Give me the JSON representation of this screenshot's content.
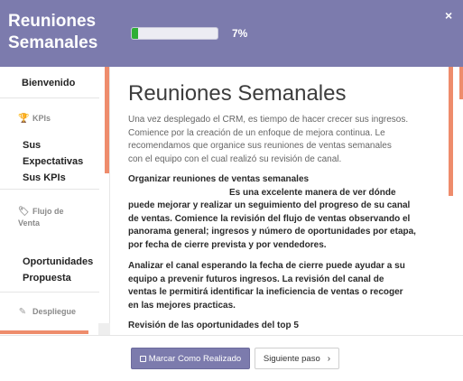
{
  "header": {
    "title": "Reuniones Semanales",
    "progress_percent": 7,
    "progress_label": "7%",
    "close_glyph": "×",
    "background_color": "#7c7bad",
    "progress_color": "#2fae36"
  },
  "sidebar": {
    "welcome": "Bienvenido",
    "kpis_section": "KPIs",
    "kpis_icon": "trophy-icon",
    "kpis_item_line1": "Sus",
    "kpis_item_line2": "Expectativas",
    "kpis_item_line3": "Sus KPIs",
    "pipeline_section_line1": "Flujo de",
    "pipeline_section_line2": "Venta",
    "pipeline_icon": "tag-icon",
    "pipeline_item_line1": "Oportunidades",
    "pipeline_item_line2": "Propuesta",
    "deploy_section": "Despliegue",
    "deploy_icon": "magic-wand-icon",
    "accent_color": "#ee8c6c"
  },
  "main": {
    "heading": "Reuniones Semanales",
    "intro_lines": [
      "Una vez desplegado el CRM, es tiempo de hacer crecer sus ingresos.",
      "Comience por la creación de un enfoque de mejora continua. Le",
      "recomendamos que organice sus reuniones de ventas semanales",
      "con el equipo con el cual realizó su revisión de canal."
    ],
    "para1_lines": [
      "Organizar reuniones de ventas semanales",
      "Es una excelente manera de ver dónde",
      "puede mejorar y realizar un seguimiento del progreso de su canal",
      "de ventas. Comience la revisión del flujo de ventas observando el",
      "panorama general; ingresos y número de oportunidades por etapa,",
      "por fecha de cierre prevista y por vendedores."
    ],
    "para2_lines": [
      "Analizar el canal esperando la fecha de cierre puede ayudar a su",
      "equipo a prevenir futuros ingresos. La revisión del canal de",
      "ventas le permitirá identificar la ineficiencia de ventas o recoger",
      "en las mejores practicas."
    ],
    "para3_lines": [
      "Revisión de las oportunidades del top 5"
    ]
  },
  "footer": {
    "mark_done": "Marcar Como Realizado",
    "next_step": "Siguiente paso",
    "next_chevron": "›"
  }
}
